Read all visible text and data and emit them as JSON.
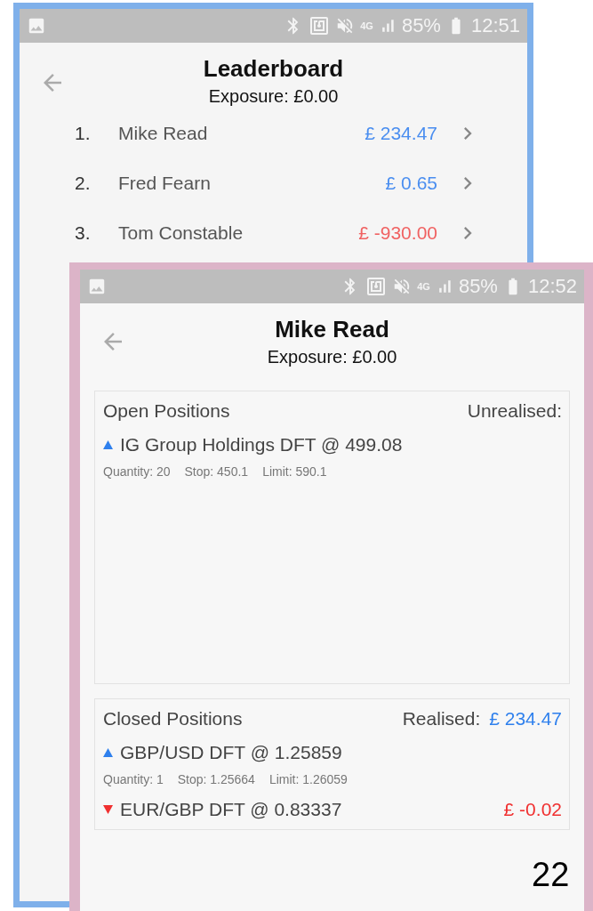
{
  "back_screen": {
    "status_bar": {
      "network": "4G",
      "battery": "85%",
      "time": "12:51"
    },
    "title": "Leaderboard",
    "subtitle": "Exposure: £0.00",
    "rows": [
      {
        "rank": "1.",
        "name": "Mike Read",
        "amount": "£ 234.47",
        "color": "#4a8ef0"
      },
      {
        "rank": "2.",
        "name": "Fred Fearn",
        "amount": "£ 0.65",
        "color": "#4a8ef0"
      },
      {
        "rank": "3.",
        "name": "Tom Constable",
        "amount": "£ -930.00",
        "color": "#f06262"
      }
    ]
  },
  "front_screen": {
    "status_bar": {
      "network": "4G",
      "battery": "85%",
      "time": "12:52"
    },
    "title": "Mike Read",
    "subtitle": "Exposure: £0.00",
    "sections": [
      {
        "heading": "Open Positions",
        "summary_label": "Unrealised:",
        "positions": [
          {
            "kind": "gain",
            "title": "IG Group Holdings DFT @ 499.08",
            "details": [
              "Quantity: 20",
              "Stop: 450.1",
              "Limit: 590.1"
            ]
          }
        ]
      },
      {
        "heading": "Closed Positions",
        "summary_label": "Realised:",
        "summary_value": "£ 234.47",
        "positions": [
          {
            "kind": "gain",
            "title": "GBP/USD DFT @ 1.25859",
            "details": [
              "Quantity: 1",
              "Stop: 1.25664",
              "Limit: 1.26059"
            ]
          },
          {
            "kind": "loss",
            "title": "EUR/GBP DFT @ 0.83337",
            "pnl": "£ -0.02"
          }
        ]
      }
    ]
  },
  "page_number": "22"
}
